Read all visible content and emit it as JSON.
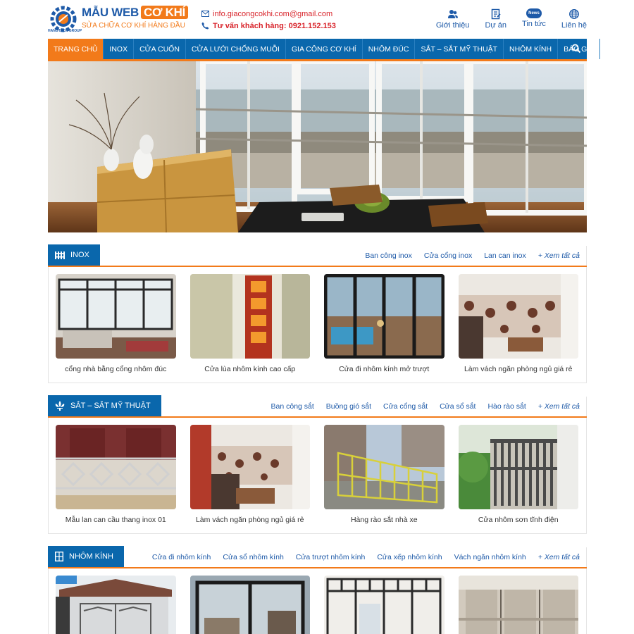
{
  "header": {
    "logo_title": "MẪU WEB",
    "logo_title_box": "CƠ KHÍ",
    "logo_subtitle": "SỬA CHỮA CƠ KHÍ HÀNG ĐẦU",
    "logo_group": "HANOTECH GROUP",
    "email": "info.giacongcokhi.com@gmail.com",
    "hotline": "Tư vấn khách hàng: 0921.152.153",
    "top_links": [
      {
        "label": "Giới thiệu",
        "icon": "users-icon"
      },
      {
        "label": "Dự án",
        "icon": "document-icon"
      },
      {
        "label": "Tin tức",
        "icon": "news-icon",
        "badge": "News"
      },
      {
        "label": "Liên hệ",
        "icon": "globe-icon"
      }
    ]
  },
  "nav": {
    "items": [
      "TRANG CHỦ",
      "INOX",
      "CỬA CUỐN",
      "CỬA LƯỚI CHỐNG MUỖI",
      "GIA CÔNG CƠ KHÍ",
      "NHÔM ĐÚC",
      "SẮT – SẮT MỸ THUẬT",
      "NHÔM KÍNH",
      "BÁO GIÁ"
    ],
    "active_index": 0
  },
  "sections": [
    {
      "title": "INOX",
      "links": [
        "Ban công inox",
        "Cửa cổng inox",
        "Lan can inox"
      ],
      "more": "+ Xem tất cả",
      "products": [
        "cổng nhà bằng cổng nhôm đúc",
        "Cửa lùa nhôm kính cao cấp",
        "Cửa đi nhôm kính mở trượt",
        "Làm vách ngăn phòng ngủ giá rẻ"
      ]
    },
    {
      "title": "SẮT – SẮT MỸ THUẬT",
      "links": [
        "Ban công sắt",
        "Buồng gió sắt",
        "Cửa cổng sắt",
        "Cửa sổ sắt",
        "Hào rào sắt"
      ],
      "more": "+ Xem tất cả",
      "products": [
        "Mẫu lan can cầu thang inox 01",
        "Làm vách ngăn phòng ngủ giá rẻ",
        "Hàng rào sắt nhà xe",
        "Cửa nhôm sơn tĩnh điện"
      ]
    },
    {
      "title": "NHÔM KÍNH",
      "links": [
        "Cửa đi nhôm kính",
        "Cửa sổ nhôm kính",
        "Cửa trượt nhôm kính",
        "Cửa xếp nhôm kính",
        "Vách ngăn nhôm kính"
      ],
      "more": "+ Xem tất cả",
      "products": [
        "",
        "",
        "",
        ""
      ]
    }
  ],
  "colors": {
    "primary": "#0a67ac",
    "accent": "#f27a1a",
    "hotline": "#d8232a"
  }
}
